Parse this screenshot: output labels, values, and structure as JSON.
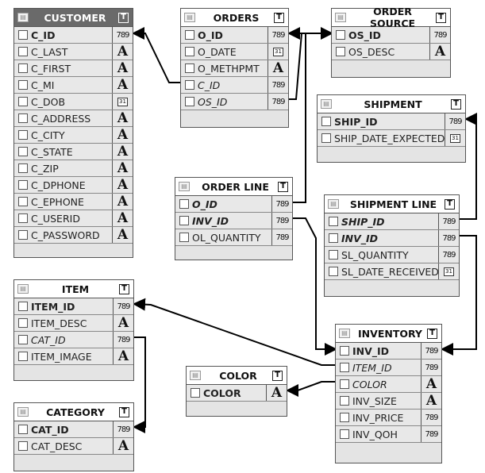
{
  "type_icons": {
    "number": "789",
    "text": "A",
    "date": "31",
    "table": "T"
  },
  "selected_table": "CUSTOMER",
  "tables": [
    {
      "name": "CUSTOMER",
      "columns": [
        {
          "name": "C_ID",
          "type": "number",
          "pk": true,
          "fk": false
        },
        {
          "name": "C_LAST",
          "type": "text"
        },
        {
          "name": "C_FIRST",
          "type": "text"
        },
        {
          "name": "C_MI",
          "type": "text"
        },
        {
          "name": "C_DOB",
          "type": "date"
        },
        {
          "name": "C_ADDRESS",
          "type": "text"
        },
        {
          "name": "C_CITY",
          "type": "text"
        },
        {
          "name": "C_STATE",
          "type": "text"
        },
        {
          "name": "C_ZIP",
          "type": "text"
        },
        {
          "name": "C_DPHONE",
          "type": "text"
        },
        {
          "name": "C_EPHONE",
          "type": "text"
        },
        {
          "name": "C_USERID",
          "type": "text"
        },
        {
          "name": "C_PASSWORD",
          "type": "text"
        }
      ]
    },
    {
      "name": "ORDERS",
      "columns": [
        {
          "name": "O_ID",
          "type": "number",
          "pk": true
        },
        {
          "name": "O_DATE",
          "type": "date"
        },
        {
          "name": "O_METHPMT",
          "type": "text"
        },
        {
          "name": "C_ID",
          "type": "number",
          "fk": true
        },
        {
          "name": "OS_ID",
          "type": "number",
          "fk": true
        }
      ]
    },
    {
      "name": "ORDER SOURCE",
      "columns": [
        {
          "name": "OS_ID",
          "type": "number",
          "pk": true
        },
        {
          "name": "OS_DESC",
          "type": "text"
        }
      ]
    },
    {
      "name": "SHIPMENT",
      "columns": [
        {
          "name": "SHIP_ID",
          "type": "number",
          "pk": true
        },
        {
          "name": "SHIP_DATE_EXPECTED",
          "type": "date"
        }
      ]
    },
    {
      "name": "ORDER LINE",
      "columns": [
        {
          "name": "O_ID",
          "type": "number",
          "pk": true,
          "fk": true
        },
        {
          "name": "INV_ID",
          "type": "number",
          "pk": true,
          "fk": true
        },
        {
          "name": "OL_QUANTITY",
          "type": "number"
        }
      ]
    },
    {
      "name": "SHIPMENT LINE",
      "columns": [
        {
          "name": "SHIP_ID",
          "type": "number",
          "pk": true,
          "fk": true
        },
        {
          "name": "INV_ID",
          "type": "number",
          "pk": true,
          "fk": true
        },
        {
          "name": "SL_QUANTITY",
          "type": "number"
        },
        {
          "name": "SL_DATE_RECEIVED",
          "type": "date"
        }
      ]
    },
    {
      "name": "ITEM",
      "columns": [
        {
          "name": "ITEM_ID",
          "type": "number",
          "pk": true
        },
        {
          "name": "ITEM_DESC",
          "type": "text"
        },
        {
          "name": "CAT_ID",
          "type": "number",
          "fk": true
        },
        {
          "name": "ITEM_IMAGE",
          "type": "text"
        }
      ]
    },
    {
      "name": "INVENTORY",
      "columns": [
        {
          "name": "INV_ID",
          "type": "number",
          "pk": true
        },
        {
          "name": "ITEM_ID",
          "type": "number",
          "fk": true
        },
        {
          "name": "COLOR",
          "type": "text",
          "fk": true
        },
        {
          "name": "INV_SIZE",
          "type": "text"
        },
        {
          "name": "INV_PRICE",
          "type": "number"
        },
        {
          "name": "INV_QOH",
          "type": "number"
        }
      ]
    },
    {
      "name": "COLOR",
      "columns": [
        {
          "name": "COLOR",
          "type": "text",
          "pk": true
        }
      ]
    },
    {
      "name": "CATEGORY",
      "columns": [
        {
          "name": "CAT_ID",
          "type": "number",
          "pk": true
        },
        {
          "name": "CAT_DESC",
          "type": "text"
        }
      ]
    }
  ],
  "relationships": [
    {
      "from": "ORDERS.C_ID",
      "to": "CUSTOMER.C_ID"
    },
    {
      "from": "ORDERS.OS_ID",
      "to": "ORDER SOURCE.OS_ID"
    },
    {
      "from": "ORDER LINE.O_ID",
      "to": "ORDERS.O_ID"
    },
    {
      "from": "ORDER LINE.INV_ID",
      "to": "INVENTORY.INV_ID"
    },
    {
      "from": "SHIPMENT LINE.SHIP_ID",
      "to": "SHIPMENT.SHIP_ID"
    },
    {
      "from": "SHIPMENT LINE.INV_ID",
      "to": "INVENTORY.INV_ID"
    },
    {
      "from": "INVENTORY.ITEM_ID",
      "to": "ITEM.ITEM_ID"
    },
    {
      "from": "INVENTORY.COLOR",
      "to": "COLOR.COLOR"
    },
    {
      "from": "ITEM.CAT_ID",
      "to": "CATEGORY.CAT_ID"
    }
  ]
}
